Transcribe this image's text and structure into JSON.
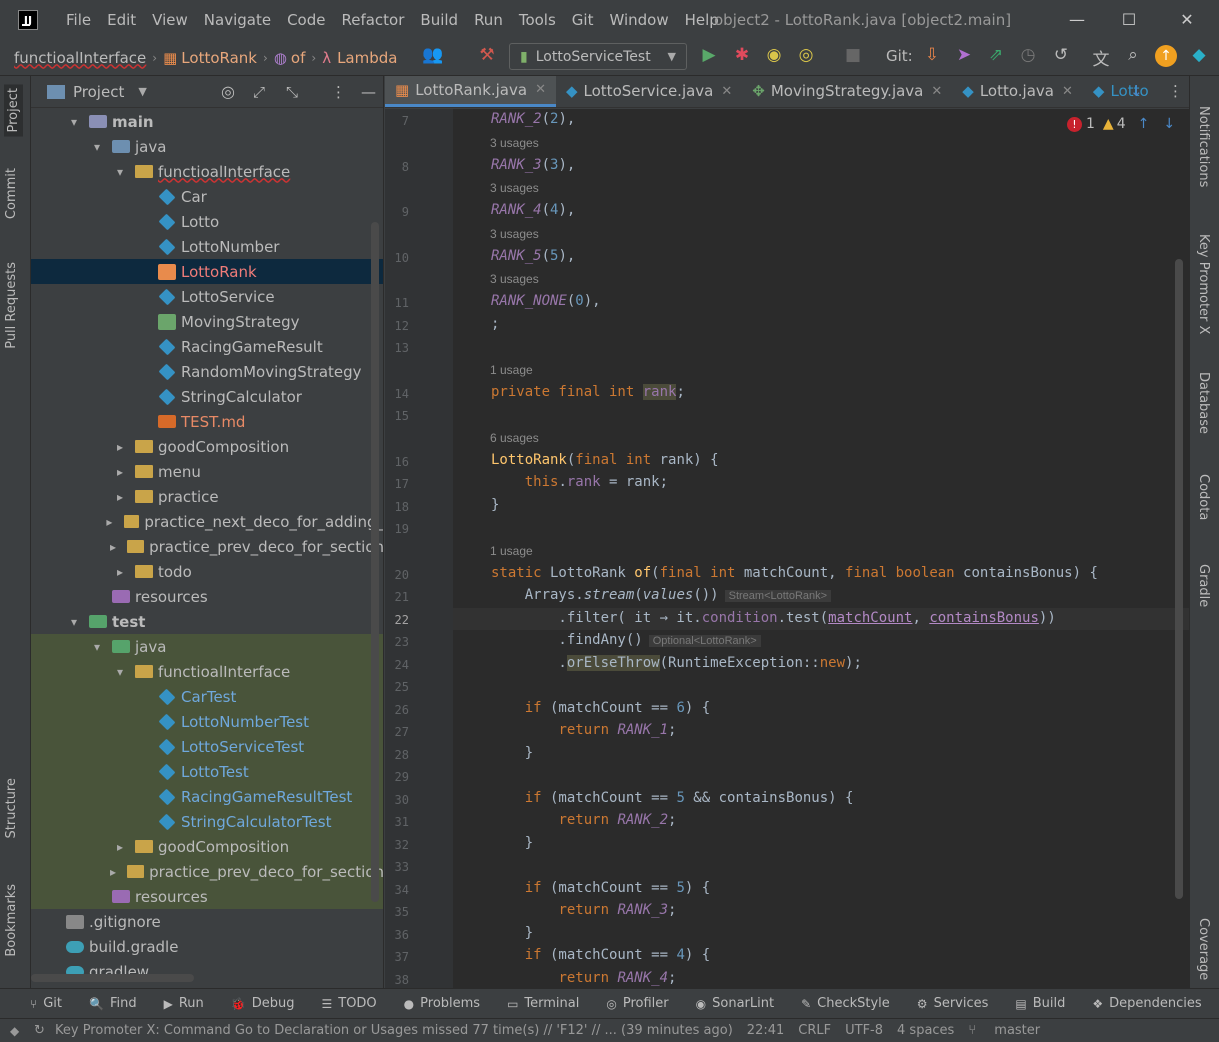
{
  "menu": [
    "File",
    "Edit",
    "View",
    "Navigate",
    "Code",
    "Refactor",
    "Build",
    "Run",
    "Tools",
    "Git",
    "Window",
    "Help"
  ],
  "window_title": "object2 - LottoRank.java [object2.main]",
  "breadcrumbs": [
    "functioalInterface",
    "LottoRank",
    "of",
    "Lambda"
  ],
  "run_config": "LottoServiceTest",
  "git_label": "Git:",
  "project_panel": {
    "title": "Project"
  },
  "tree": [
    {
      "label": "main",
      "indent": 2,
      "type": "modfolder",
      "arrow": "▾",
      "bold": true
    },
    {
      "label": "java",
      "indent": 3,
      "type": "srcfolder",
      "arrow": "▾"
    },
    {
      "label": "functioalInterface",
      "indent": 4,
      "type": "folder",
      "arrow": "▾",
      "wavy": true
    },
    {
      "label": "Car",
      "indent": 5,
      "type": "cls"
    },
    {
      "label": "Lotto",
      "indent": 5,
      "type": "cls"
    },
    {
      "label": "LottoNumber",
      "indent": 5,
      "type": "cls"
    },
    {
      "label": "LottoRank",
      "indent": 5,
      "type": "enum",
      "selected": true,
      "color": "#f07c79"
    },
    {
      "label": "LottoService",
      "indent": 5,
      "type": "cls"
    },
    {
      "label": "MovingStrategy",
      "indent": 5,
      "type": "iface"
    },
    {
      "label": "RacingGameResult",
      "indent": 5,
      "type": "cls"
    },
    {
      "label": "RandomMovingStrategy",
      "indent": 5,
      "type": "cls"
    },
    {
      "label": "StringCalculator",
      "indent": 5,
      "type": "cls"
    },
    {
      "label": "TEST.md",
      "indent": 5,
      "type": "md",
      "color": "#e88a66"
    },
    {
      "label": "goodComposition",
      "indent": 4,
      "type": "folder",
      "arrow": "▸"
    },
    {
      "label": "menu",
      "indent": 4,
      "type": "folder",
      "arrow": "▸"
    },
    {
      "label": "practice",
      "indent": 4,
      "type": "folder",
      "arrow": "▸"
    },
    {
      "label": "practice_next_deco_for_adding_",
      "indent": 4,
      "type": "folder",
      "arrow": "▸"
    },
    {
      "label": "practice_prev_deco_for_section",
      "indent": 4,
      "type": "folder",
      "arrow": "▸"
    },
    {
      "label": "todo",
      "indent": 4,
      "type": "folder",
      "arrow": "▸"
    },
    {
      "label": "resources",
      "indent": 3,
      "type": "res"
    },
    {
      "label": "test",
      "indent": 2,
      "type": "testfolder",
      "arrow": "▾",
      "bold": true
    },
    {
      "label": "java",
      "indent": 3,
      "type": "testfolder",
      "arrow": "▾",
      "test": true
    },
    {
      "label": "functioalInterface",
      "indent": 4,
      "type": "folder",
      "arrow": "▾",
      "test": true
    },
    {
      "label": "CarTest",
      "indent": 5,
      "type": "cls",
      "test": true,
      "color": "#6fa8dc"
    },
    {
      "label": "LottoNumberTest",
      "indent": 5,
      "type": "cls",
      "test": true,
      "color": "#6fa8dc"
    },
    {
      "label": "LottoServiceTest",
      "indent": 5,
      "type": "cls",
      "test": true,
      "color": "#6fa8dc"
    },
    {
      "label": "LottoTest",
      "indent": 5,
      "type": "cls",
      "test": true,
      "color": "#6fa8dc"
    },
    {
      "label": "RacingGameResultTest",
      "indent": 5,
      "type": "cls",
      "test": true,
      "color": "#6fa8dc"
    },
    {
      "label": "StringCalculatorTest",
      "indent": 5,
      "type": "cls",
      "test": true,
      "color": "#6fa8dc"
    },
    {
      "label": "goodComposition",
      "indent": 4,
      "type": "folder",
      "arrow": "▸",
      "test": true
    },
    {
      "label": "practice_prev_deco_for_section",
      "indent": 4,
      "type": "folder",
      "arrow": "▸",
      "test": true
    },
    {
      "label": "resources",
      "indent": 3,
      "type": "res",
      "test": true
    },
    {
      "label": ".gitignore",
      "indent": 1,
      "type": "file"
    },
    {
      "label": "build.gradle",
      "indent": 1,
      "type": "gradle"
    },
    {
      "label": "gradlew",
      "indent": 1,
      "type": "gradle"
    }
  ],
  "editor_tabs": [
    {
      "label": "LottoRank.java",
      "active": true
    },
    {
      "label": "LottoService.java"
    },
    {
      "label": "MovingStrategy.java"
    },
    {
      "label": "Lotto.java"
    },
    {
      "label": "Lotto"
    }
  ],
  "inspections": {
    "errors": "1",
    "warnings": "4"
  },
  "code_lines": [
    {
      "n": "7",
      "html": "<span class='enumc'>RANK_2</span>(<span class='num'>2</span>),"
    },
    {
      "hint": "3 usages"
    },
    {
      "n": "8",
      "html": "<span class='enumc'>RANK_3</span>(<span class='num'>3</span>),"
    },
    {
      "hint": "3 usages"
    },
    {
      "n": "9",
      "html": "<span class='enumc'>RANK_4</span>(<span class='num'>4</span>),"
    },
    {
      "hint": "3 usages"
    },
    {
      "n": "10",
      "html": "<span class='enumc'>RANK_5</span>(<span class='num'>5</span>),"
    },
    {
      "hint": "3 usages"
    },
    {
      "n": "11",
      "html": "<span class='enumc'>RANK_NONE</span>(<span class='num'>0</span>),"
    },
    {
      "n": "12",
      "html": ";"
    },
    {
      "n": "13",
      "html": ""
    },
    {
      "hint": "1 usage"
    },
    {
      "n": "14",
      "html": "<span class='kw'>private final int</span> <span class='fld' style='background:#4b4b3a'>rank</span>;"
    },
    {
      "n": "15",
      "html": ""
    },
    {
      "hint": "6 usages"
    },
    {
      "n": "16",
      "html": "<span class='fn'>LottoRank</span>(<span class='kw'>final int</span> rank) {"
    },
    {
      "n": "17",
      "html": "    <span class='kw'>this</span>.<span class='fld'>rank</span> = rank;"
    },
    {
      "n": "18",
      "html": "}"
    },
    {
      "n": "19",
      "html": ""
    },
    {
      "hint": "1 usage"
    },
    {
      "n": "20",
      "html": "<span class='kw'>static</span> LottoRank <span class='fn'>of</span>(<span class='kw'>final int</span> matchCount, <span class='kw'>final boolean</span> containsBonus) {"
    },
    {
      "n": "21",
      "html": "    Arrays.<span class='it'>stream</span>(<span class='it'>values</span>())<span class='inl'>Stream&lt;LottoRank&gt;</span>"
    },
    {
      "n": "22",
      "html": "        .filter( it → it.<span class='fld'>condition</span>.test(<span class='param'>matchCount</span>, <span class='param'>containsBonus</span>))",
      "cur": true
    },
    {
      "n": "23",
      "html": "        .findAny()<span class='inl'>Optional&lt;LottoRank&gt;</span>"
    },
    {
      "n": "24",
      "html": "        .<span style='background:#4b4b3a'>orElseThrow</span>(RuntimeException::<span class='kw'>new</span>);"
    },
    {
      "n": "25",
      "html": ""
    },
    {
      "n": "26",
      "html": "    <span class='kw'>if</span> (matchCount == <span class='num'>6</span>) {"
    },
    {
      "n": "27",
      "html": "        <span class='kw'>return</span> <span class='enumc'>RANK_1</span>;"
    },
    {
      "n": "28",
      "html": "    }"
    },
    {
      "n": "29",
      "html": ""
    },
    {
      "n": "30",
      "html": "    <span class='kw'>if</span> (matchCount == <span class='num'>5</span> &amp;&amp; containsBonus) {"
    },
    {
      "n": "31",
      "html": "        <span class='kw'>return</span> <span class='enumc'>RANK_2</span>;"
    },
    {
      "n": "32",
      "html": "    }"
    },
    {
      "n": "33",
      "html": ""
    },
    {
      "n": "34",
      "html": "    <span class='kw'>if</span> (matchCount == <span class='num'>5</span>) {"
    },
    {
      "n": "35",
      "html": "        <span class='kw'>return</span> <span class='enumc'>RANK_3</span>;"
    },
    {
      "n": "36",
      "html": "    }"
    },
    {
      "n": "37",
      "html": "    <span class='kw'>if</span> (matchCount == <span class='num'>4</span>) {"
    },
    {
      "n": "38",
      "html": "        <span class='kw'>return</span> <span class='enumc'>RANK_4</span>;"
    }
  ],
  "left_tabs": [
    "Project",
    "Commit",
    "Pull Requests",
    "Structure",
    "Bookmarks"
  ],
  "right_tabs": [
    "Notifications",
    "Key Promoter X",
    "Database",
    "Codota",
    "Gradle",
    "Coverage"
  ],
  "tool_windows": [
    {
      "label": "Git",
      "icon": "⑂"
    },
    {
      "label": "Find",
      "icon": "🔍"
    },
    {
      "label": "Run",
      "icon": "▶"
    },
    {
      "label": "Debug",
      "icon": "🐞"
    },
    {
      "label": "TODO",
      "icon": "☰"
    },
    {
      "label": "Problems",
      "icon": "●"
    },
    {
      "label": "Terminal",
      "icon": "▭"
    },
    {
      "label": "Profiler",
      "icon": "◎"
    },
    {
      "label": "SonarLint",
      "icon": "◉"
    },
    {
      "label": "CheckStyle",
      "icon": "✎"
    },
    {
      "label": "Services",
      "icon": "⚙"
    },
    {
      "label": "Build",
      "icon": "▤"
    },
    {
      "label": "Dependencies",
      "icon": "❖"
    }
  ],
  "status_bar": {
    "message": "Key Promoter X: Command Go to Declaration or Usages missed 77 time(s) // 'F12' // ... (39 minutes ago)",
    "position": "22:41",
    "line_sep": "CRLF",
    "encoding": "UTF-8",
    "indent": "4 spaces",
    "branch": "master"
  }
}
